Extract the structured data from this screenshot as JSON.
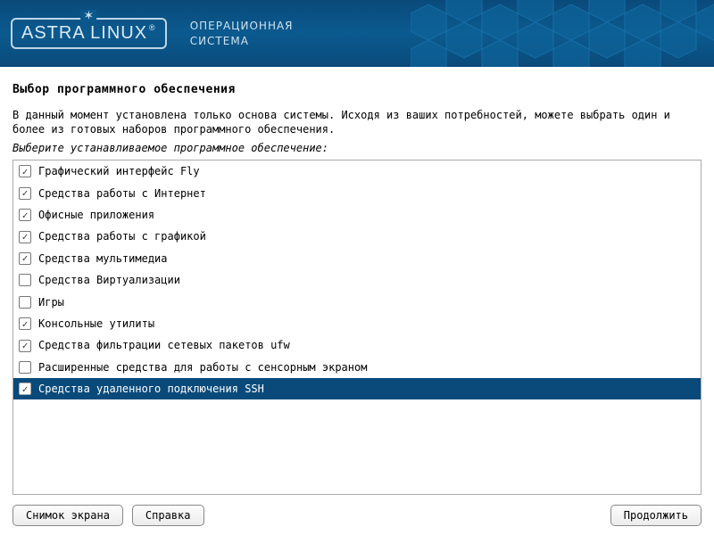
{
  "brand": {
    "logo": "ASTRA LINUX",
    "registered": "®",
    "subtitle_line1": "ОПЕРАЦИОННАЯ",
    "subtitle_line2": "СИСТЕМА"
  },
  "page": {
    "title": "Выбор программного обеспечения",
    "intro": "В данный момент установлена только основа системы. Исходя из ваших потребностей, можете выбрать один и более из готовых наборов программного обеспечения.",
    "prompt": "Выберите устанавливаемое программное обеспечение:"
  },
  "software": [
    {
      "label": "Графический интерфейс Fly",
      "checked": true,
      "selected": false
    },
    {
      "label": "Средства работы с Интернет",
      "checked": true,
      "selected": false
    },
    {
      "label": "Офисные приложения",
      "checked": true,
      "selected": false
    },
    {
      "label": "Средства работы с графикой",
      "checked": true,
      "selected": false
    },
    {
      "label": "Средства мультимедиа",
      "checked": true,
      "selected": false
    },
    {
      "label": "Средства Виртуализации",
      "checked": false,
      "selected": false
    },
    {
      "label": "Игры",
      "checked": false,
      "selected": false
    },
    {
      "label": "Консольные утилиты",
      "checked": true,
      "selected": false
    },
    {
      "label": "Средства фильтрации сетевых пакетов ufw",
      "checked": true,
      "selected": false
    },
    {
      "label": "Расширенные средства для работы с сенсорным экраном",
      "checked": false,
      "selected": false
    },
    {
      "label": "Средства удаленного подключения SSH",
      "checked": true,
      "selected": true
    }
  ],
  "buttons": {
    "screenshot": "Снимок экрана",
    "help": "Справка",
    "continue": "Продолжить"
  }
}
